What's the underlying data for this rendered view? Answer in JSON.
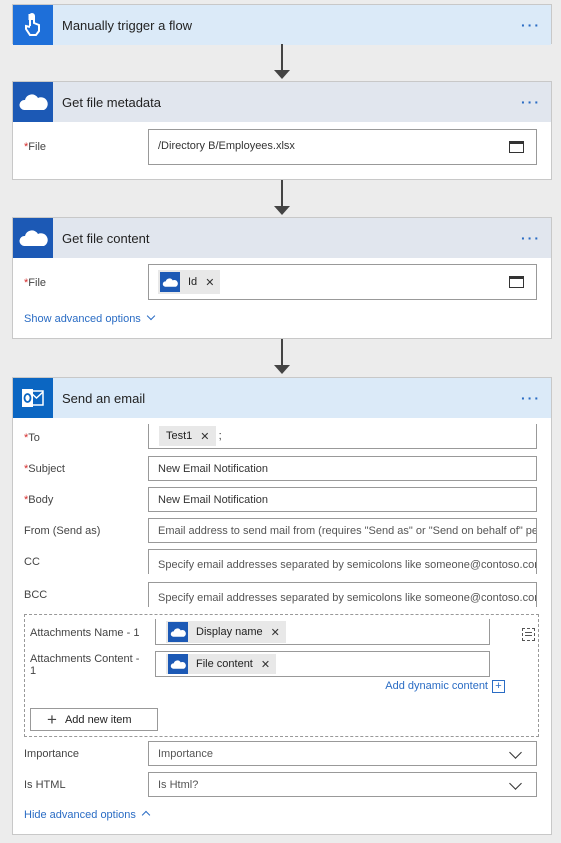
{
  "trigger": {
    "title": "Manually trigger a flow",
    "more": "···"
  },
  "metadata": {
    "title": "Get file metadata",
    "more": "···",
    "file_label": "File",
    "file_value": "/Directory B/Employees.xlsx"
  },
  "content": {
    "title": "Get file content",
    "more": "···",
    "file_label": "File",
    "file_token": "Id",
    "advanced_link": "Show advanced options"
  },
  "email": {
    "title": "Send an email",
    "more": "···",
    "to_label": "To",
    "to_token": "Test1",
    "to_sep": ";",
    "subject_label": "Subject",
    "subject_value": "New Email Notification",
    "body_label": "Body",
    "body_value": "New Email Notification",
    "from_label": "From (Send as)",
    "from_placeholder": "Email address to send mail from (requires \"Send as\" or \"Send on behalf of\" pe",
    "cc_label": "CC",
    "cc_placeholder": "Specify email addresses separated by semicolons like someone@contoso.com",
    "bcc_label": "BCC",
    "bcc_placeholder": "Specify email addresses separated by semicolons like someone@contoso.com",
    "att_name_label": "Attachments Name - 1",
    "att_name_token": "Display name",
    "att_content_label_1": "Attachments Content -",
    "att_content_label_2": "1",
    "att_content_token": "File content",
    "add_dynamic": "Add dynamic content",
    "add_new_item": "Add new item",
    "importance_label": "Importance",
    "importance_value": "Importance",
    "ishtml_label": "Is HTML",
    "ishtml_value": "Is Html?",
    "hide_link": "Hide advanced options"
  },
  "colors": {
    "accent": "#2a6cc4",
    "required": "#d42b2b",
    "onedrive": "#1c59b5",
    "outlook": "#0b66c2"
  }
}
